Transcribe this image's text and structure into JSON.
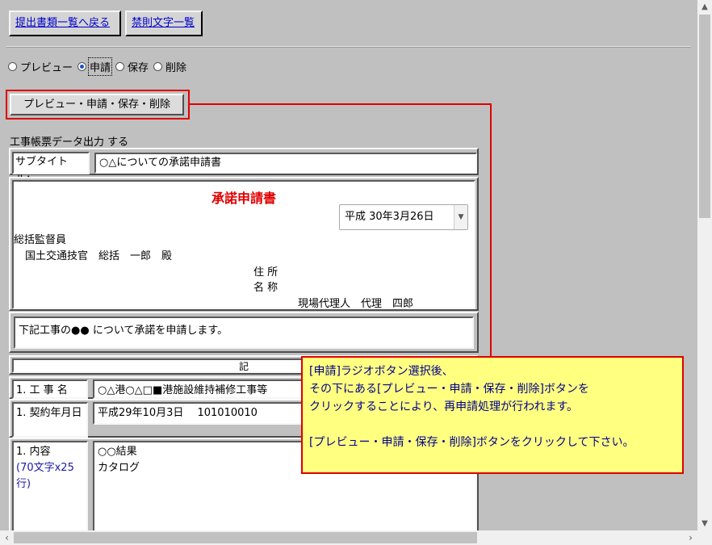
{
  "top_buttons": {
    "back": "提出書類一覧へ戻る",
    "forbidden": "禁則文字一覧"
  },
  "radios": [
    {
      "label": "プレビュー",
      "checked": false
    },
    {
      "label": "申請",
      "checked": true
    },
    {
      "label": "保存",
      "checked": false
    },
    {
      "label": "削除",
      "checked": false
    }
  ],
  "action_button": "プレビュー・申請・保存・削除",
  "section_label": "工事帳票データ出力 する",
  "form": {
    "subtitle_label": "サブタイトル：",
    "subtitle_value": "○△についての承諾申請書",
    "doc_title": "承諾申請書",
    "date_value": "平成 30年3月26日",
    "recipient_title": "総括監督員",
    "recipient_name": "国土交通技官　総括　一郎　殿",
    "address_label": "住 所",
    "name_label": "名 称",
    "agent": "現場代理人　代理　四郎",
    "request_text": "下記工事の●● について承諾を申請します。",
    "ki": "記",
    "rows": {
      "project_label": "1. 工 事 名",
      "project_value": "○△港○△□■港施設維持補修工事等",
      "contract_label": "1. 契約年月日",
      "contract_value": "平成29年10月3日　 101010010",
      "content_label": "1. 内容",
      "content_limit": "(70文字x25行)",
      "content_line1": "○○結果",
      "content_line2": "カタログ"
    }
  },
  "callout": {
    "line1": "[申請]ラジオボタン選択後、",
    "line2": "その下にある[プレビュー・申請・保存・削除]ボタンを",
    "line3": "クリックすることにより、再申請処理が行われます。",
    "line4": "[プレビュー・申請・保存・削除]ボタンをクリックして下さい。"
  },
  "colors": {
    "highlight": "#e00000",
    "callout_bg": "#ffff80",
    "callout_text": "#00008b"
  }
}
